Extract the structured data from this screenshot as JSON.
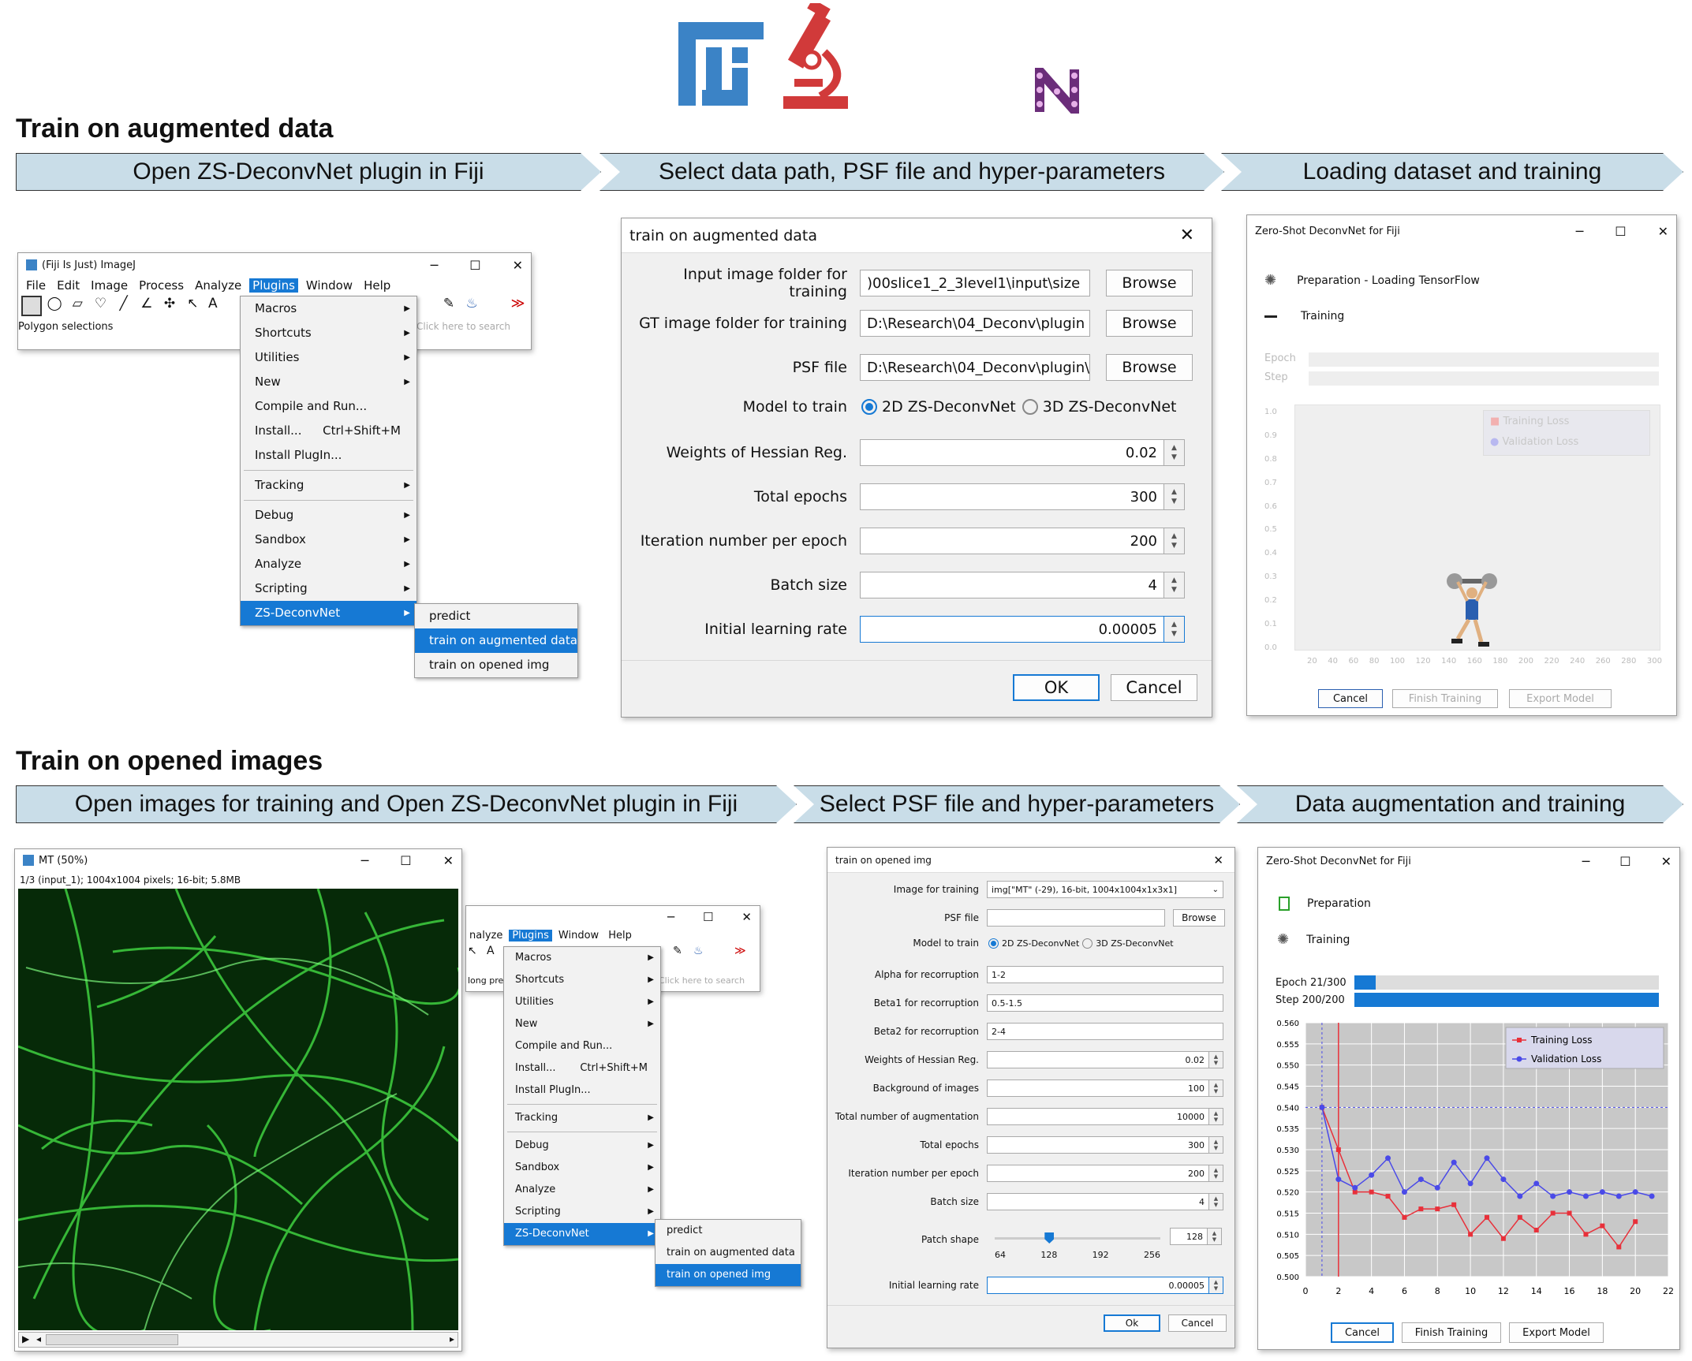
{
  "logos": {
    "fiji": "Fiji logo",
    "microscope": "microscope-icon",
    "n": "N logo"
  },
  "section1": {
    "title": "Train on augmented data",
    "steps": [
      "Open ZS-DeconvNet plugin in Fiji",
      "Select data path, PSF file and hyper-parameters",
      "Loading dataset and training"
    ]
  },
  "section2": {
    "title": "Train on opened images",
    "steps": [
      "Open images for training and Open ZS-DeconvNet plugin in Fiji",
      "Select PSF file and hyper-parameters",
      "Data augmentation and training"
    ]
  },
  "imagej": {
    "title": "(Fiji Is Just) ImageJ",
    "menus": [
      "File",
      "Edit",
      "Image",
      "Process",
      "Analyze",
      "Plugins",
      "Window",
      "Help"
    ],
    "status": "Polygon selections",
    "search_placeholder": "Click here to search",
    "plugins_menu": [
      "Macros",
      "Shortcuts",
      "Utilities",
      "New",
      "Compile and Run...",
      "Install...",
      "Install PlugIn...",
      "Tracking",
      "Debug",
      "Sandbox",
      "Analyze",
      "Scripting",
      "ZS-DeconvNet"
    ],
    "install_shortcut": "Ctrl+Shift+M",
    "submenu": [
      "predict",
      "train on augmented data",
      "train on opened img"
    ]
  },
  "dialog1": {
    "title": "train on augmented data",
    "input_label": "Input image folder for training",
    "input_value": ")00slice1_2_3level1\\input\\size",
    "gt_label": "GT image folder for training",
    "gt_value": "D:\\Research\\04_Deconv\\plugin",
    "psf_label": "PSF file",
    "psf_value": "D:\\Research\\04_Deconv\\plugin\\",
    "browse": "Browse",
    "model_label": "Model to train",
    "model_2d": "2D ZS-DeconvNet",
    "model_3d": "3D ZS-DeconvNet",
    "hessian_label": "Weights of Hessian Reg.",
    "hessian_value": "0.02",
    "epochs_label": "Total epochs",
    "epochs_value": "300",
    "iter_label": "Iteration number per epoch",
    "iter_value": "200",
    "batch_label": "Batch size",
    "batch_value": "4",
    "lr_label": "Initial learning rate",
    "lr_value": "0.00005",
    "ok": "OK",
    "cancel": "Cancel"
  },
  "train1": {
    "title": "Zero-Shot DeconvNet for Fiji",
    "prep": "Preparation - Loading TensorFlow",
    "training": "Training",
    "epoch": "Epoch",
    "step": "Step",
    "legend_train": "Training Loss",
    "legend_val": "Validation Loss",
    "yticks": [
      "1.0",
      "0.9",
      "0.8",
      "0.7",
      "0.6",
      "0.5",
      "0.4",
      "0.3",
      "0.2",
      "0.1",
      "0.0"
    ],
    "xticks": [
      "20",
      "40",
      "60",
      "80",
      "100",
      "120",
      "140",
      "160",
      "180",
      "200",
      "220",
      "240",
      "260",
      "280",
      "300"
    ],
    "cancel": "Cancel",
    "finish": "Finish Training",
    "export": "Export Model"
  },
  "mt_window": {
    "title": "MT (50%)",
    "info": "1/3 (input_1); 1004x1004 pixels; 16-bit; 5.8MB"
  },
  "imagej2": {
    "menus": [
      "nalyze",
      "Plugins",
      "Window",
      "Help"
    ],
    "status": "long pre",
    "search_placeholder": "Click here to search"
  },
  "dialog2": {
    "title": "train on opened img",
    "image_label": "Image for training",
    "image_value": "img[\"MT\" (-29), 16-bit, 1004x1004x1x3x1]",
    "psf_label": "PSF file",
    "browse": "Browse",
    "model_label": "Model to train",
    "model_2d": "2D ZS-DeconvNet",
    "model_3d": "3D ZS-DeconvNet",
    "alpha_label": "Alpha for recorruption",
    "alpha_value": "1-2",
    "beta1_label": "Beta1 for recorruption",
    "beta1_value": "0.5-1.5",
    "beta2_label": "Beta2 for recorruption",
    "beta2_value": "2-4",
    "hessian_label": "Weights of Hessian Reg.",
    "hessian_value": "0.02",
    "bg_label": "Background of images",
    "bg_value": "100",
    "aug_label": "Total number of augmentation",
    "aug_value": "10000",
    "epochs_label": "Total epochs",
    "epochs_value": "300",
    "iter_label": "Iteration number per epoch",
    "iter_value": "200",
    "batch_label": "Batch size",
    "batch_value": "4",
    "patch_label": "Patch shape",
    "patch_value": "128",
    "patch_ticks": [
      "64",
      "128",
      "192",
      "256"
    ],
    "patch_slider": 0.33,
    "lr_label": "Initial learning rate",
    "lr_value": "0.00005",
    "ok": "Ok",
    "cancel": "Cancel"
  },
  "train2": {
    "title": "Zero-Shot DeconvNet for Fiji",
    "prep": "Preparation",
    "training": "Training",
    "epoch_label": "Epoch 21/300",
    "step_label": "Step 200/200",
    "epoch_progress": 0.07,
    "step_progress": 1.0,
    "cancel": "Cancel",
    "finish": "Finish Training",
    "export": "Export Model"
  },
  "chart_data": {
    "type": "line",
    "legend": [
      "Training Loss",
      "Validation Loss"
    ],
    "legend_position": "top-right",
    "ylim": [
      0.5,
      0.56
    ],
    "xlim": [
      0,
      22
    ],
    "yticks": [
      "0.560",
      "0.555",
      "0.550",
      "0.545",
      "0.540",
      "0.535",
      "0.530",
      "0.525",
      "0.520",
      "0.515",
      "0.510",
      "0.505",
      "0.500"
    ],
    "xticks": [
      "0",
      "2",
      "4",
      "6",
      "8",
      "10",
      "12",
      "14",
      "16",
      "18",
      "20",
      "22"
    ],
    "series": [
      {
        "name": "Training Loss",
        "color": "#e8303a",
        "x": [
          1,
          2,
          3,
          4,
          5,
          6,
          7,
          8,
          9,
          10,
          11,
          12,
          13,
          14,
          15,
          16,
          17,
          18,
          19,
          20
        ],
        "y": [
          0.54,
          0.53,
          0.52,
          0.52,
          0.519,
          0.514,
          0.516,
          0.516,
          0.517,
          0.51,
          0.514,
          0.509,
          0.514,
          0.511,
          0.515,
          0.515,
          0.51,
          0.512,
          0.507,
          0.513
        ]
      },
      {
        "name": "Validation Loss",
        "color": "#4a4ae8",
        "x": [
          1,
          2,
          3,
          4,
          5,
          6,
          7,
          8,
          9,
          10,
          11,
          12,
          13,
          14,
          15,
          16,
          17,
          18,
          19,
          20,
          21
        ],
        "y": [
          0.54,
          0.523,
          0.521,
          0.524,
          0.528,
          0.52,
          0.523,
          0.521,
          0.527,
          0.522,
          0.528,
          0.523,
          0.519,
          0.522,
          0.519,
          0.52,
          0.519,
          0.52,
          0.519,
          0.52,
          0.519
        ]
      }
    ]
  },
  "colors": {
    "arrow_fill": "#c9dde8",
    "accent": "#1679d4",
    "fiji_blue": "#3b83c6",
    "microscope_red": "#d13a3a",
    "n_purple": "#6b2d7a"
  }
}
